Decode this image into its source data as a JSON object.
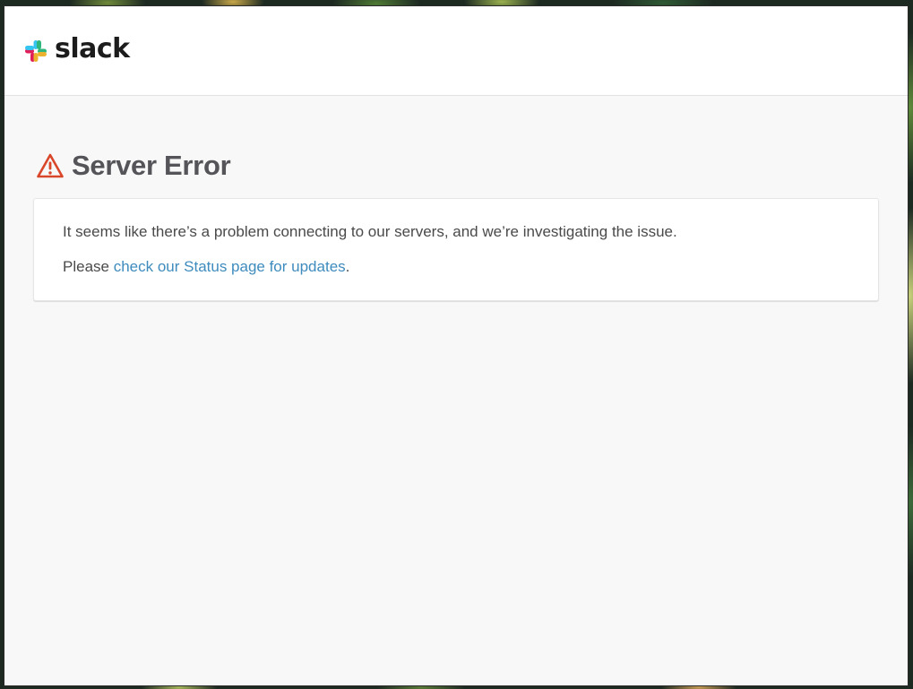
{
  "brand": {
    "name": "slack",
    "colors": {
      "blue": "#36C5F0",
      "green": "#2EB67D",
      "yellow": "#ECB22E",
      "red": "#E01E5A"
    }
  },
  "error": {
    "icon": "warning-triangle-icon",
    "icon_color": "#d9472b",
    "title": "Server Error",
    "message": "It seems like there’s a problem connecting to our servers, and we’re investigating the issue.",
    "status_prefix": "Please ",
    "status_link": "check our Status page for updates",
    "status_suffix": "."
  },
  "colors": {
    "link": "#3e8bbd",
    "title": "#555459",
    "body_text": "#4a4a4a",
    "page_bg": "#f8f8f8"
  }
}
